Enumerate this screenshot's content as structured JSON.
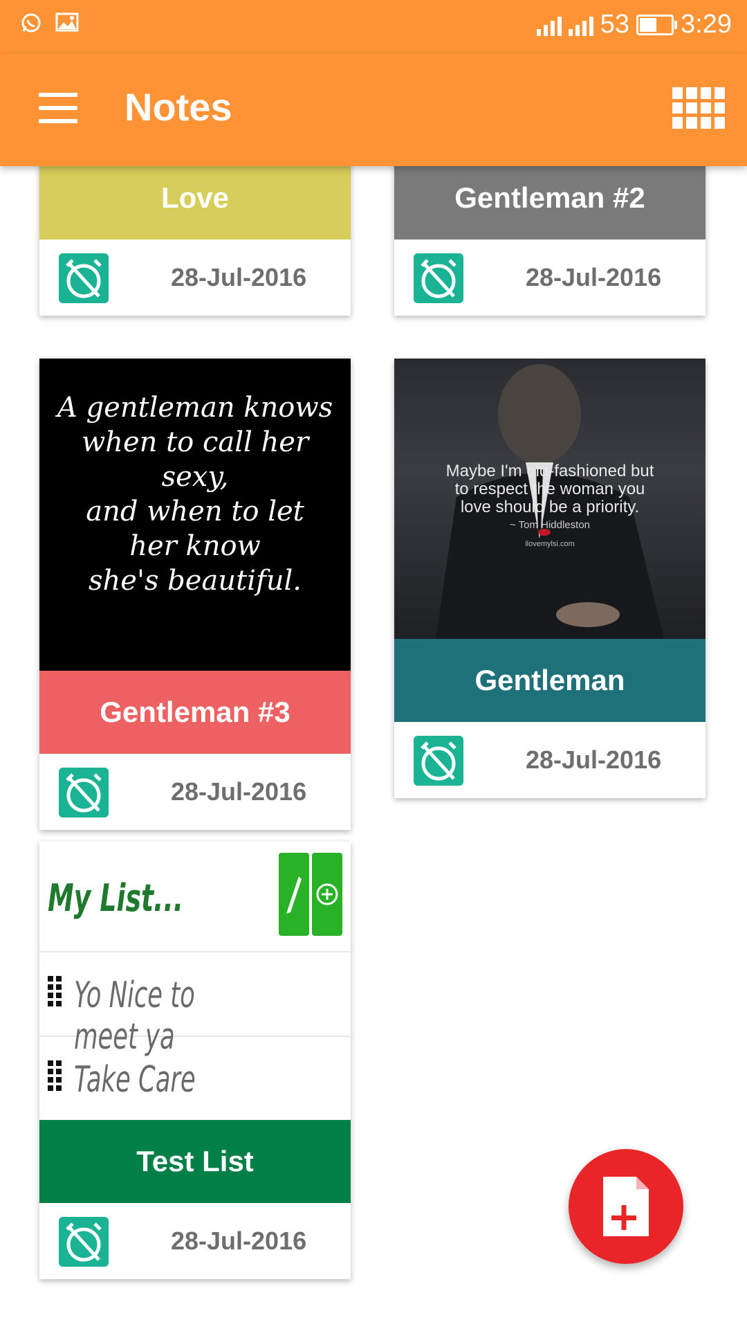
{
  "status_bar": {
    "signal_label": "53",
    "time": "3:29"
  },
  "app_bar": {
    "title": "Notes"
  },
  "colors": {
    "accent": "#fd9334",
    "card_love": "#d7cd5a",
    "card_gentleman2": "#7a7a7a",
    "card_gentleman3": "#ee6163",
    "card_gentleman": "#1e7079",
    "card_testlist": "#007f46",
    "alarm": "#1ab394",
    "fab": "#ea2528"
  },
  "cards": [
    {
      "title": "Love",
      "date": "28-Jul-2016"
    },
    {
      "title": "Gentleman #2",
      "date": "28-Jul-2016"
    },
    {
      "title": "Gentleman #3",
      "date": "28-Jul-2016",
      "image_lines": [
        "A gentleman knows",
        "when to call her",
        "sexy,",
        "and when to let",
        "her know",
        "she's beautiful."
      ]
    },
    {
      "title": "Gentleman",
      "date": "28-Jul-2016",
      "image_lines": [
        "Maybe I'm old-fashioned but",
        "to respect the woman you",
        "love should be a priority."
      ],
      "image_author": "~ Tom Hiddleston",
      "image_site": "ilovemylsi.com"
    },
    {
      "title": "Test List",
      "date": "28-Jul-2016",
      "list_name": "My List...",
      "list_items": [
        "Yo Nice to meet ya",
        "Take Care"
      ]
    }
  ],
  "icons": {
    "menu": "hamburger-menu-icon",
    "grid": "grid-view-icon",
    "alarm": "alarm-off-icon",
    "fab": "add-note-icon"
  }
}
